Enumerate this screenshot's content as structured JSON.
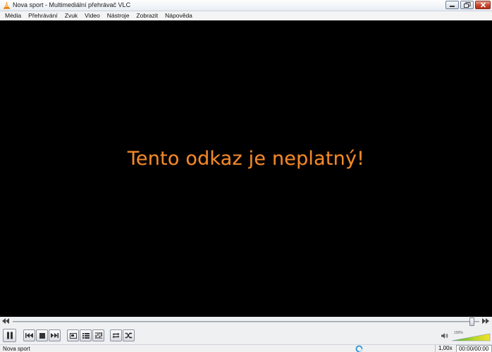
{
  "window": {
    "title": "Nova sport - Multimediální přehrávač VLC",
    "app_icon": "vlc-cone-icon",
    "buttons": [
      "minimize-icon",
      "maximize-icon",
      "close-icon"
    ]
  },
  "menu": {
    "items": [
      "Média",
      "Přehrávání",
      "Zvuk",
      "Video",
      "Nástroje",
      "Zobrazit",
      "Nápověda"
    ]
  },
  "video": {
    "message": "Tento odkaz je neplatný!",
    "message_color": "#f0892b",
    "background_color": "#000000"
  },
  "seekbar": {
    "position_fraction": 0.99,
    "back_icon": "seek-back-icon",
    "forward_icon": "seek-forward-icon"
  },
  "controls": {
    "buttons": [
      "pause-icon",
      "previous-icon",
      "stop-icon",
      "next-icon",
      "fullscreen-icon",
      "playlist-icon",
      "extended-settings-icon",
      "loop-icon",
      "shuffle-icon"
    ],
    "volume": {
      "label": "100%",
      "level_fraction": 1.0,
      "icon": "speaker-icon"
    }
  },
  "status": {
    "title": "Nova sport",
    "rate": "1,00x",
    "time": "00:00/00:00",
    "buffer_icon": "buffering-icon"
  },
  "colors": {
    "accent": "#f0892b",
    "chrome": "#eef0f2",
    "close_button": "#c8442a"
  }
}
